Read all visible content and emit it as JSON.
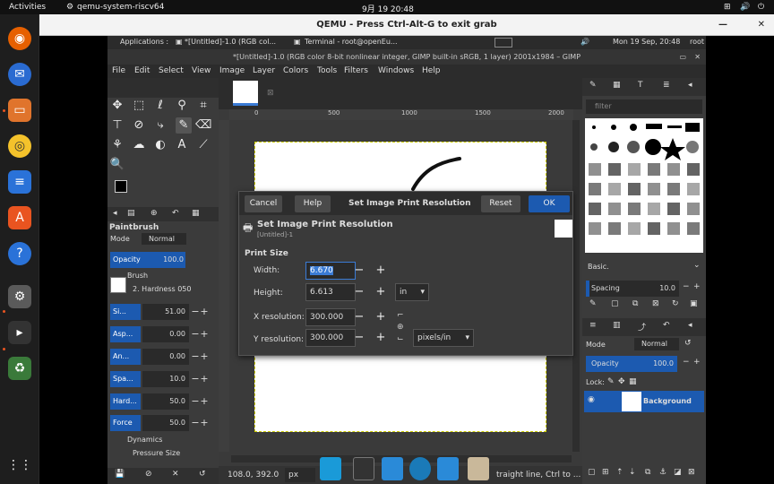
{
  "topbar": {
    "activities": "Activities",
    "app": "qemu-system-riscv64",
    "clock": "9月 19 20:48"
  },
  "qemu": {
    "title": "QEMU - Press Ctrl-Alt-G to exit grab"
  },
  "guest_panel": {
    "applications": "Applications :",
    "task1": "*[Untitled]-1.0 (RGB col...",
    "task2": "Terminal - root@openEu...",
    "datetime": "Mon 19 Sep, 20:48",
    "user": "root"
  },
  "gimp": {
    "title": "*[Untitled]-1.0 (RGB color 8-bit nonlinear integer, GIMP built-in sRGB, 1 layer) 2001x1984 – GIMP",
    "menu": [
      "File",
      "Edit",
      "Select",
      "View",
      "Image",
      "Layer",
      "Colors",
      "Tools",
      "Filters",
      "Windows",
      "Help"
    ],
    "ruler": [
      "0",
      "500",
      "1000",
      "1500",
      "2000"
    ],
    "tool_options": {
      "tool": "Paintbrush",
      "mode_label": "Mode",
      "mode_value": "Normal",
      "opacity_label": "Opacity",
      "opacity_value": "100.0",
      "brush_label": "Brush",
      "brush_value": "2. Hardness 050",
      "rows": [
        {
          "label": "Si...",
          "value": "51.00"
        },
        {
          "label": "Asp...",
          "value": "0.00"
        },
        {
          "label": "An...",
          "value": "0.00"
        },
        {
          "label": "Spa...",
          "value": "10.0"
        },
        {
          "label": "Hard...",
          "value": "50.0"
        },
        {
          "label": "Force",
          "value": "50.0"
        }
      ],
      "dynamics_label": "Dynamics",
      "dynamics_value": "Pressure Size"
    },
    "brushes": {
      "filter": "filter",
      "preset": "Basic.",
      "spacing_label": "Spacing",
      "spacing_value": "10.0"
    },
    "layers": {
      "mode_label": "Mode",
      "mode_value": "Normal",
      "opacity_label": "Opacity",
      "opacity_value": "100.0",
      "lock_label": "Lock:",
      "layer_name": "Background"
    },
    "status": {
      "coords": "108.0, 392.0",
      "unit": "px",
      "hint": "traight line, Ctrl to ..."
    }
  },
  "dialog": {
    "cancel": "Cancel",
    "help": "Help",
    "title": "Set Image Print Resolution",
    "reset": "Reset",
    "ok": "OK",
    "heading": "Set Image Print Resolution",
    "subheading": "[Untitled]-1",
    "section": "Print Size",
    "width_label": "Width:",
    "width_value": "6.670",
    "height_label": "Height:",
    "height_value": "6.613",
    "size_unit": "in",
    "xres_label": "X resolution:",
    "xres_value": "300.000",
    "yres_label": "Y resolution:",
    "yres_value": "300.000",
    "res_unit": "pixels/in"
  },
  "colors": {
    "ubuntu_orange": "#e95420",
    "gimp_blue": "#1c5ab0",
    "selection_blue": "#3a7bd5"
  }
}
